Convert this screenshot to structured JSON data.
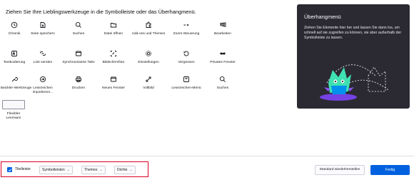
{
  "heading": "Ziehen Sie Ihre Lieblingswerkzeuge in die Symbolleiste oder das Überhangmenü.",
  "tools": [
    {
      "label": "Chronik",
      "icon": "clock-icon",
      "name": "tool-chronik"
    },
    {
      "label": "Seite speichern",
      "icon": "save-page-icon",
      "name": "tool-seite-speichern"
    },
    {
      "label": "Suchen",
      "icon": "search-icon",
      "name": "tool-suchen"
    },
    {
      "label": "Datei öffnen",
      "icon": "folder-icon",
      "name": "tool-datei-oeffnen"
    },
    {
      "label": "Add-ons und Themes",
      "icon": "puzzle-icon",
      "name": "tool-addons"
    },
    {
      "label": "Zoom-Steuerung",
      "icon": "zoom-control-icon",
      "name": "tool-zoom"
    },
    {
      "label": "Bearbeiten",
      "icon": "edit-clipboard-icon",
      "name": "tool-bearbeiten"
    },
    {
      "label": "Textkodierung",
      "icon": "text-encoding-icon",
      "name": "tool-textkodierung"
    },
    {
      "label": "Link senden",
      "icon": "send-link-icon",
      "name": "tool-link-senden"
    },
    {
      "label": "Synchronisierte Tabs",
      "icon": "synced-tabs-icon",
      "name": "tool-sync-tabs"
    },
    {
      "label": "Bildschirmfoto",
      "icon": "screenshot-icon",
      "name": "tool-bildschirmfoto"
    },
    {
      "label": "Einstellungen",
      "icon": "gear-icon",
      "name": "tool-einstellungen"
    },
    {
      "label": "Vergessen",
      "icon": "forget-icon",
      "name": "tool-vergessen"
    },
    {
      "label": "Privates Fenster",
      "icon": "private-mask-icon",
      "name": "tool-privates-fenster"
    },
    {
      "label": "Entwickler-Werkzeuge",
      "icon": "wrench-icon",
      "name": "tool-entwickler"
    },
    {
      "label": "Lesezeichen importieren...",
      "icon": "import-icon",
      "name": "tool-lesezeichen-import"
    },
    {
      "label": "Drucken",
      "icon": "printer-icon",
      "name": "tool-drucken"
    },
    {
      "label": "Neues Fenster",
      "icon": "new-window-icon",
      "name": "tool-neues-fenster"
    },
    {
      "label": "Vollbild",
      "icon": "fullscreen-icon",
      "name": "tool-vollbild"
    },
    {
      "label": "Lesezeichen-Menü",
      "icon": "bookmark-menu-icon",
      "name": "tool-lesezeichen-menue"
    },
    {
      "label": "Suchen",
      "icon": "search-icon",
      "name": "tool-suchen-2"
    },
    {
      "label": "Flexibler Leerraum",
      "icon": "flexible-space-box",
      "name": "tool-flexibler-leerraum"
    }
  ],
  "overflow": {
    "title": "Überhangmenü",
    "description": "Ziehen Sie Elemente hier her und lassen Sie dann los, um schnell auf sie zugreifen zu können, sie aber außerhalb der Symbolleiste zu lassen."
  },
  "footer": {
    "titlebar_label": "Titelleiste",
    "titlebar_checked": true,
    "toolbars_label": "Symbolleisten",
    "themes_label": "Themes",
    "density_label": "Dichte",
    "restore_label": "Standard wiederherstellen",
    "done_label": "Fertig"
  },
  "colors": {
    "accent": "#0061e0",
    "highlight": "#d70022",
    "panel_bg": "#2b2a33",
    "illustration_purple": "#7542e5",
    "illustration_cyan": "#3fe1b0"
  }
}
